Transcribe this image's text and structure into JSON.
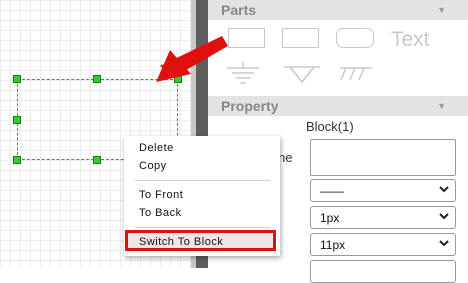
{
  "parts": {
    "title": "Parts",
    "text_shape_label": "Text"
  },
  "property": {
    "title": "Property",
    "block_label": "Block(1)",
    "name_label_partial": "ne",
    "line_style_value": "——",
    "line_width_value": "1px",
    "font_size_value": "11px"
  },
  "context_menu": {
    "items": [
      "Delete",
      "Copy",
      "To Front",
      "To Back",
      "Switch To Block"
    ],
    "highlighted_item": "Switch To Block"
  },
  "colors": {
    "highlight_border": "#e01010",
    "arrow": "#e01010",
    "handle": "#2ed02e",
    "section_header": "#e3e3e3"
  },
  "icons": {
    "collapse": "chevron-down-icon",
    "dropdown": "chevron-down-icon",
    "annotation_arrow": "red-arrow-icon"
  }
}
